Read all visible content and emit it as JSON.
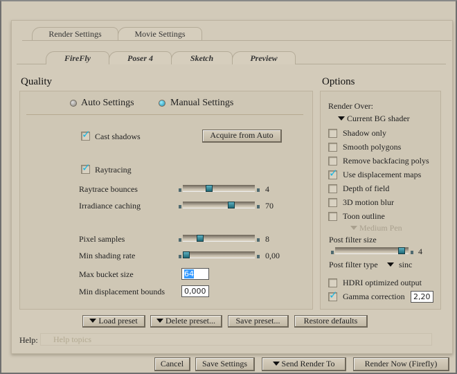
{
  "tabs": [
    {
      "label": "Render Settings",
      "active": true
    },
    {
      "label": "Movie Settings",
      "active": false
    }
  ],
  "subtabs": [
    {
      "label": "FireFly",
      "active": true
    },
    {
      "label": "Poser 4"
    },
    {
      "label": "Sketch"
    },
    {
      "label": "Preview"
    }
  ],
  "quality": {
    "title": "Quality",
    "mode_auto": "Auto Settings",
    "mode_manual": "Manual Settings",
    "selected_mode": "manual",
    "cast_shadows": {
      "label": "Cast shadows",
      "checked": true
    },
    "acquire_button": "Acquire from Auto",
    "raytracing": {
      "label": "Raytracing",
      "checked": true
    },
    "sliders": [
      {
        "label": "Raytrace bounces",
        "value": "4",
        "fraction": 0.35
      },
      {
        "label": "Irradiance caching",
        "value": "70",
        "fraction": 0.7
      },
      {
        "label": "Pixel samples",
        "value": "8",
        "fraction": 0.22
      },
      {
        "label": "Min shading rate",
        "value": "0,00",
        "fraction": 0.0
      }
    ],
    "max_bucket_size": {
      "label": "Max bucket size",
      "value": "64"
    },
    "min_displacement_bounds": {
      "label": "Min displacement bounds",
      "value": "0,000"
    }
  },
  "options": {
    "title": "Options",
    "render_over_label": "Render Over:",
    "render_over_value": "Current BG shader",
    "checkboxes": [
      {
        "label": "Shadow only",
        "checked": false
      },
      {
        "label": "Smooth polygons",
        "checked": false
      },
      {
        "label": "Remove backfacing polys",
        "checked": false
      },
      {
        "label": "Use displacement maps",
        "checked": true
      },
      {
        "label": "Depth of field",
        "checked": false
      },
      {
        "label": "3D motion blur",
        "checked": false
      },
      {
        "label": "Toon outline",
        "checked": false
      }
    ],
    "toon_pen": "Medium Pen",
    "post_filter_size": {
      "label": "Post filter size",
      "value": "4",
      "fraction": 0.95
    },
    "post_filter_type": {
      "label": "Post filter type",
      "value": "sinc"
    },
    "hdri": {
      "label": "HDRI optimized output",
      "checked": false
    },
    "gamma": {
      "label": "Gamma correction",
      "checked": true,
      "value": "2,20"
    }
  },
  "preset_buttons": {
    "load": "Load preset",
    "delete": "Delete preset...",
    "save": "Save preset...",
    "restore": "Restore defaults"
  },
  "help": {
    "label": "Help:",
    "placeholder": "Help topics"
  },
  "footer": {
    "cancel": "Cancel",
    "save_settings": "Save Settings",
    "send_render_to": "Send Render To",
    "render_now": "Render Now (Firefly)"
  }
}
